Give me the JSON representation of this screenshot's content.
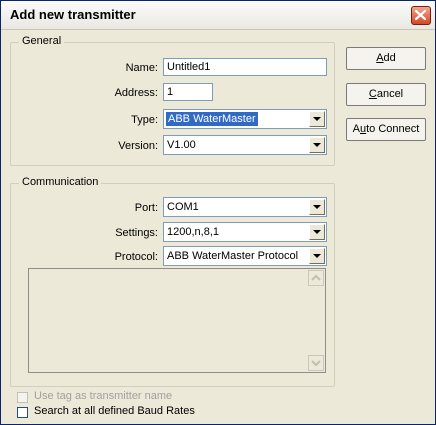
{
  "window": {
    "title": "Add new transmitter"
  },
  "general": {
    "legend": "General",
    "name_label": "Name:",
    "name_value": "Untitled1",
    "address_label": "Address:",
    "address_value": "1",
    "type_label": "Type:",
    "type_value": "ABB WaterMaster",
    "version_label": "Version:",
    "version_value": "V1.00"
  },
  "communication": {
    "legend": "Communication",
    "port_label": "Port:",
    "port_value": "COM1",
    "settings_label": "Settings:",
    "settings_value": "1200,n,8,1",
    "protocol_label": "Protocol:",
    "protocol_value": "ABB WaterMaster Protocol"
  },
  "buttons": {
    "add_mnemonic": "A",
    "add_rest": "dd",
    "cancel_mnemonic": "C",
    "cancel_rest": "ancel",
    "auto_first": "A",
    "auto_mnemonic": "u",
    "auto_rest": "to Connect"
  },
  "options": {
    "use_tag_label": "Use tag as transmitter name",
    "use_tag_checked": false,
    "use_tag_enabled": false,
    "search_baud_label": "Search at all defined Baud Rates",
    "search_baud_checked": false
  },
  "colors": {
    "selection": "#316ac5",
    "close_button": "#d2482a"
  }
}
